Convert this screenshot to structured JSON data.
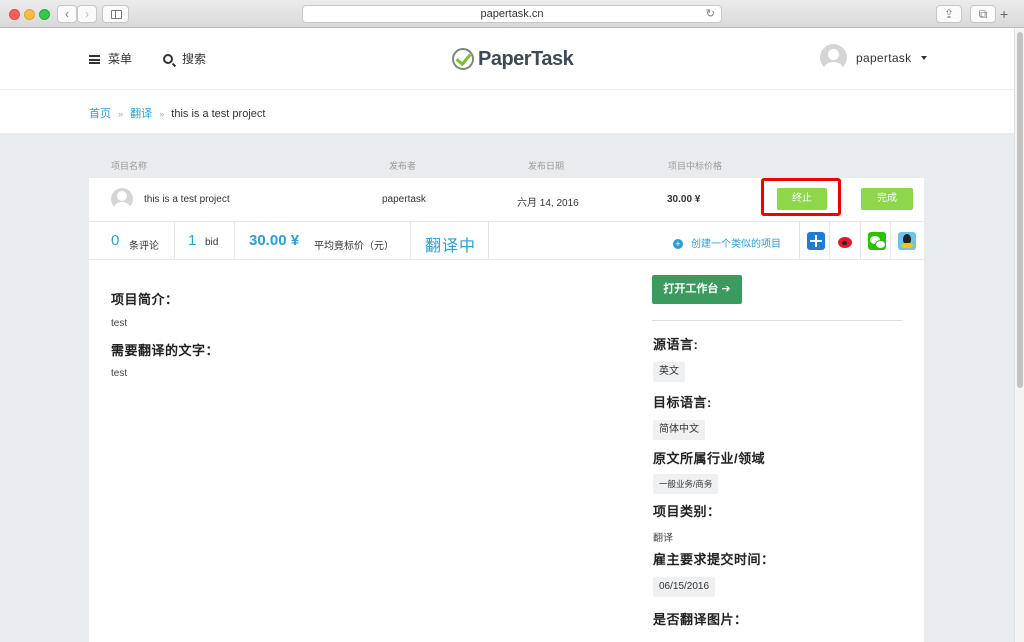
{
  "browser": {
    "url": "papertask.cn",
    "back_glyph": "‹",
    "forward_glyph": "›",
    "reload_glyph": "↻",
    "share_glyph": "⇪",
    "tabs_glyph": "⧉",
    "new_tab_glyph": "+"
  },
  "header": {
    "menu_label": "菜单",
    "search_label": "搜索",
    "logo_text": "PaperTask",
    "username": "papertask"
  },
  "breadcrumb": {
    "home": "首页",
    "category": "翻译",
    "current": "this is a test project",
    "separator": "»"
  },
  "table": {
    "headers": [
      "项目名称",
      "发布者",
      "发布日期",
      "项目中标价格"
    ],
    "row": {
      "name": "this is a test project",
      "publisher": "papertask",
      "date": "六月 14, 2016",
      "price": "30.00 ¥",
      "stop_label": "终止",
      "finish_label": "完成"
    }
  },
  "stats": {
    "comments_count": "0",
    "comments_label": "条评论",
    "bids_count": "1",
    "bids_label": "bid",
    "avg_price": "30.00 ¥",
    "avg_price_label": "平均竟标价（元）",
    "status": "翻译中",
    "create_similar": "创建一个类似的项目"
  },
  "main": {
    "intro_title": "项目简介：",
    "intro_value": "test",
    "text_title": "需要翻译的文字：",
    "text_value": "test",
    "workbench_label": "打开工作台 ➔",
    "source_lang_title": "源语言:",
    "source_lang_value": "英文",
    "target_lang_title": "目标语言:",
    "target_lang_value": "简体中文",
    "industry_title": "原文所属行业/领域",
    "industry_value": "一般业务/商务",
    "category_title": "项目类别：",
    "category_value": "翻译",
    "deadline_title": "雇主要求提交时间：",
    "deadline_value": "06/15/2016",
    "translate_images_title": "是否翻译图片："
  },
  "colors": {
    "accent_blue": "#2a9fd6",
    "button_green": "#8ed64a",
    "workbench_green": "#3c9a5f",
    "highlight_red": "#ee0000"
  },
  "icons": [
    "back-icon",
    "forward-icon",
    "sidebar-icon",
    "reload-icon",
    "share-icon",
    "tabs-icon",
    "hamburger-icon",
    "search-icon",
    "logo-check-icon",
    "avatar-icon",
    "caret-down-icon",
    "plus-circle-icon",
    "add-share-icon",
    "weibo-icon",
    "wechat-icon",
    "qq-icon"
  ]
}
